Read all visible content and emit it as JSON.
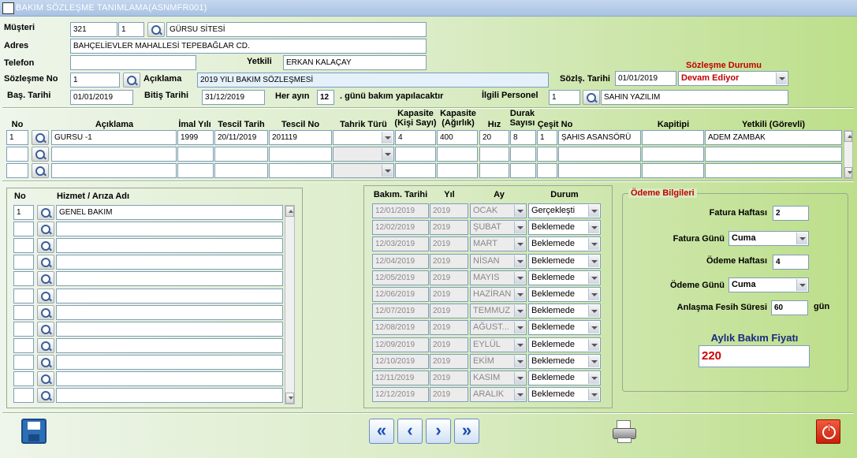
{
  "window": {
    "title": "BAKIM SÖZLEŞME TANIMLAMA(ASNMFR001)"
  },
  "form": {
    "musteri_label": "Müşteri",
    "musteri_kod": "321",
    "musteri_sube": "1",
    "musteri_ad": "GÜRSU SİTESİ",
    "adres_label": "Adres",
    "adres": "BAHÇELİEVLER MAHALLESİ TEPEBAĞLAR CD.",
    "telefon_label": "Telefon",
    "telefon": "",
    "yetkili_label": "Yetkili",
    "yetkili": "ERKAN KALAÇAY",
    "sozlesme_durumu_label": "Sözleşme Durumu",
    "sozlesme_durumu": "Devam Ediyor",
    "sozlesme_no_label": "Sözleşme No",
    "sozlesme_no": "1",
    "aciklama_label": "Açıklama",
    "aciklama": "2019 YILI BAKIM SÖZLEŞMESİ",
    "sozlesme_tarihi_label": "Sözlş. Tarihi",
    "sozlesme_tarihi": "01/01/2019",
    "bas_tarihi_label": "Baş. Tarihi",
    "bas_tarihi": "01/01/2019",
    "bitis_tarihi_label": "Bitiş Tarihi",
    "bitis_tarihi": "31/12/2019",
    "her_ayin_label": "Her ayın",
    "gun": "12",
    "gun_suffix": ". günü bakım yapılacaktır",
    "ilgili_personel_label": "İlgili Personel",
    "personel_kod": "1",
    "personel_ad": "SAHIN YAZILIM"
  },
  "elevators": {
    "headers": {
      "no": "No",
      "aciklama": "Açıklama",
      "imal_yili": "İmal Yılı",
      "tescil_tarih": "Tescil Tarih",
      "tescil_no": "Tescil No",
      "tahrik_turu": "Tahrik Türü",
      "kapasite_kisi": "Kapasite (Kişi Sayı)",
      "kapasite_agirlik": "Kapasite (Ağırlık)",
      "hiz": "Hız",
      "durak_sayisi": "Durak Sayısı",
      "cesit_no": "Çeşit No",
      "kapitipi": "Kapitipi",
      "yetkili": "Yetkili (Görevli)"
    },
    "rows": [
      {
        "no": "1",
        "aciklama": "GURSU -1",
        "imal_yili": "1999",
        "tescil_tarih": "20/11/2019",
        "tescil_no": "201119",
        "tahrik_turu": "",
        "kisi": "4",
        "agirlik": "400",
        "hiz": "20",
        "durak": "8",
        "cesit": "1",
        "cesit_no": "ŞAHIS ASANSÖRÜ",
        "kapitipi": "",
        "yetkili": "ADEM ZAMBAK"
      },
      {
        "no": "",
        "aciklama": "",
        "imal_yili": "",
        "tescil_tarih": "",
        "tescil_no": "",
        "tahrik_turu": "",
        "kisi": "",
        "agirlik": "",
        "hiz": "",
        "durak": "",
        "cesit": "",
        "cesit_no": "",
        "kapitipi": "",
        "yetkili": ""
      },
      {
        "no": "",
        "aciklama": "",
        "imal_yili": "",
        "tescil_tarih": "",
        "tescil_no": "",
        "tahrik_turu": "",
        "kisi": "",
        "agirlik": "",
        "hiz": "",
        "durak": "",
        "cesit": "",
        "cesit_no": "",
        "kapitipi": "",
        "yetkili": ""
      }
    ]
  },
  "services": {
    "headers": {
      "no": "No",
      "ad": "Hizmet / Arıza Adı"
    },
    "rows": [
      {
        "no": "1",
        "ad": "GENEL BAKIM"
      },
      {
        "no": "",
        "ad": ""
      },
      {
        "no": "",
        "ad": ""
      },
      {
        "no": "",
        "ad": ""
      },
      {
        "no": "",
        "ad": ""
      },
      {
        "no": "",
        "ad": ""
      },
      {
        "no": "",
        "ad": ""
      },
      {
        "no": "",
        "ad": ""
      },
      {
        "no": "",
        "ad": ""
      },
      {
        "no": "",
        "ad": ""
      },
      {
        "no": "",
        "ad": ""
      },
      {
        "no": "",
        "ad": ""
      }
    ]
  },
  "schedule": {
    "headers": {
      "tarih": "Bakım. Tarihi",
      "yil": "Yıl",
      "ay": "Ay",
      "durum": "Durum"
    },
    "rows": [
      {
        "tarih": "12/01/2019",
        "yil": "2019",
        "ay": "OCAK",
        "durum": "Gerçekleşti"
      },
      {
        "tarih": "12/02/2019",
        "yil": "2019",
        "ay": "ŞUBAT",
        "durum": "Beklemede"
      },
      {
        "tarih": "12/03/2019",
        "yil": "2019",
        "ay": "MART",
        "durum": "Beklemede"
      },
      {
        "tarih": "12/04/2019",
        "yil": "2019",
        "ay": "NİSAN",
        "durum": "Beklemede"
      },
      {
        "tarih": "12/05/2019",
        "yil": "2019",
        "ay": "MAYIS",
        "durum": "Beklemede"
      },
      {
        "tarih": "12/06/2019",
        "yil": "2019",
        "ay": "HAZİRAN",
        "durum": "Beklemede"
      },
      {
        "tarih": "12/07/2019",
        "yil": "2019",
        "ay": "TEMMUZ",
        "durum": "Beklemede"
      },
      {
        "tarih": "12/08/2019",
        "yil": "2019",
        "ay": "AĞUST...",
        "durum": "Beklemede"
      },
      {
        "tarih": "12/09/2019",
        "yil": "2019",
        "ay": "EYLÜL",
        "durum": "Beklemede"
      },
      {
        "tarih": "12/10/2019",
        "yil": "2019",
        "ay": "EKİM",
        "durum": "Beklemede"
      },
      {
        "tarih": "12/11/2019",
        "yil": "2019",
        "ay": "KASIM",
        "durum": "Beklemede"
      },
      {
        "tarih": "12/12/2019",
        "yil": "2019",
        "ay": "ARALIK",
        "durum": "Beklemede"
      }
    ]
  },
  "payment": {
    "title": "Ödeme Bilgileri",
    "fatura_haftasi_label": "Fatura Haftası",
    "fatura_haftasi": "2",
    "fatura_gunu_label": "Fatura Günü",
    "fatura_gunu": "Cuma",
    "odeme_haftasi_label": "Ödeme Haftası",
    "odeme_haftasi": "4",
    "odeme_gunu_label": "Ödeme Günü",
    "odeme_gunu": "Cuma",
    "fesih_label": "Anlaşma Fesih Süresi",
    "fesih": "60",
    "fesih_unit": "gün",
    "fiyat_label": "Aylık Bakım Fiyatı",
    "fiyat": "220"
  },
  "toolbar": {
    "first": "«",
    "prev": "‹",
    "next": "›",
    "last": "»"
  }
}
